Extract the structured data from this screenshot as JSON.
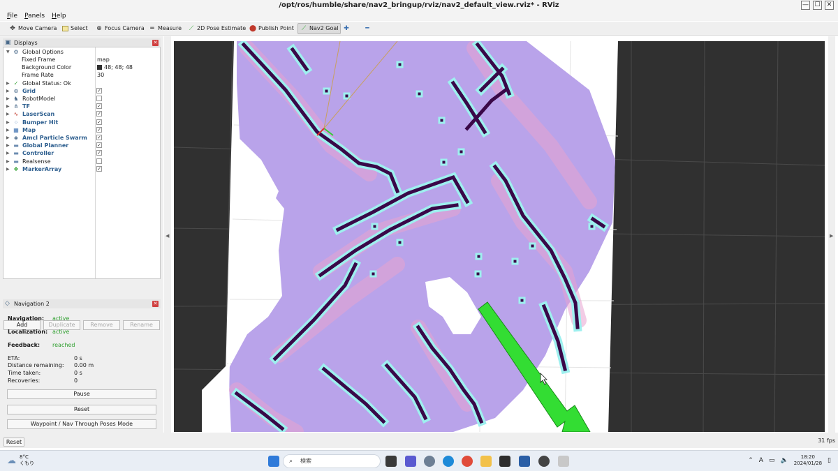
{
  "window": {
    "title": "/opt/ros/humble/share/nav2_bringup/rviz/nav2_default_view.rviz* - RViz",
    "buttons": [
      "—",
      "☐",
      "✕"
    ]
  },
  "menu": [
    {
      "label": "File",
      "accel": "F",
      "rest": "ile"
    },
    {
      "label": "Panels",
      "accel": "P",
      "rest": "anels"
    },
    {
      "label": "Help",
      "accel": "H",
      "rest": "elp"
    }
  ],
  "toolbar": [
    {
      "label": "Move Camera",
      "icon": "move-camera-icon"
    },
    {
      "label": "Select",
      "icon": "select-icon"
    },
    {
      "label": "Focus Camera",
      "icon": "focus-camera-icon"
    },
    {
      "label": "Measure",
      "icon": "measure-icon"
    },
    {
      "label": "2D Pose Estimate",
      "icon": "pose-estimate-icon"
    },
    {
      "label": "Publish Point",
      "icon": "publish-point-icon"
    },
    {
      "label": "Nav2 Goal",
      "icon": "nav2-goal-icon",
      "active": true
    }
  ],
  "displays": {
    "title": "Displays",
    "rows": [
      {
        "label": "Global Options",
        "expanded": true,
        "icon": "gear-icon"
      },
      {
        "label": "Fixed Frame",
        "value": "map",
        "child": true
      },
      {
        "label": "Background Color",
        "value": "48; 48; 48",
        "child": true,
        "swatch": "#303030"
      },
      {
        "label": "Frame Rate",
        "value": "30",
        "child": true
      },
      {
        "label": "Global Status: Ok",
        "icon": "check-icon"
      },
      {
        "label": "Grid",
        "checked": true,
        "blue": true,
        "icon": "grid-icon"
      },
      {
        "label": "RobotModel",
        "checked": false,
        "icon": "robot-icon"
      },
      {
        "label": "TF",
        "checked": true,
        "blue": true,
        "icon": "tf-icon"
      },
      {
        "label": "LaserScan",
        "checked": true,
        "blue": true,
        "icon": "laser-icon"
      },
      {
        "label": "Bumper Hit",
        "checked": true,
        "blue": true,
        "icon": "bumper-icon"
      },
      {
        "label": "Map",
        "checked": true,
        "blue": true,
        "icon": "map-icon"
      },
      {
        "label": "Amcl Particle Swarm",
        "checked": true,
        "blue": true,
        "icon": "particle-icon"
      },
      {
        "label": "Global Planner",
        "checked": true,
        "blue": true,
        "icon": "folder-icon"
      },
      {
        "label": "Controller",
        "checked": true,
        "blue": true,
        "icon": "folder-icon"
      },
      {
        "label": "Realsense",
        "checked": false,
        "icon": "folder-icon"
      },
      {
        "label": "MarkerArray",
        "checked": true,
        "blue": true,
        "icon": "marker-icon"
      }
    ],
    "buttons": {
      "add": "Add",
      "duplicate": "Duplicate",
      "remove": "Remove",
      "rename": "Rename"
    }
  },
  "navigation": {
    "title": "Navigation 2",
    "navigation_label": "Navigation:",
    "navigation_value": "active",
    "localization_label": "Localization:",
    "localization_value": "active",
    "feedback_label": "Feedback:",
    "feedback_value": "reached",
    "metrics": [
      {
        "label": "ETA:",
        "value": "0 s"
      },
      {
        "label": "Distance remaining:",
        "value": "0.00 m"
      },
      {
        "label": "Time taken:",
        "value": "0 s"
      },
      {
        "label": "Recoveries:",
        "value": "0"
      }
    ],
    "pause": "Pause",
    "reset": "Reset",
    "waypoint": "Waypoint / Nav Through Poses Mode"
  },
  "status": {
    "reset": "Reset",
    "fps": "31 fps"
  },
  "colors": {
    "background": "#303030",
    "costmap_purple": "#b6a3ea",
    "costmap_pink": "#e3a0c8",
    "costmap_cyan": "#9ef0ef",
    "obstacle": "#3a0848",
    "goal_arrow": "#33dd33"
  },
  "taskbar": {
    "weather_temp": "8°C",
    "weather_cond": "くもり",
    "search_placeholder": "検索",
    "time": "18:20",
    "date": "2024/01/28",
    "ime": "A"
  }
}
